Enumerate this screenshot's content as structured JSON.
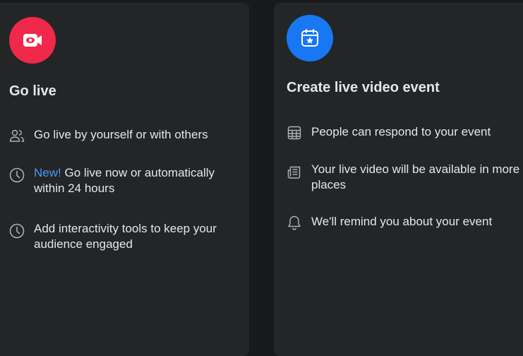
{
  "go_live": {
    "title": "Go live",
    "badge_color": "#f02849",
    "badge_icon": "video-camera-icon",
    "features": [
      {
        "icon": "people-icon",
        "text": "Go live by yourself or with others"
      },
      {
        "icon": "clock-icon",
        "tag": "New!",
        "text": "Go live now or automatically within 24 hours"
      },
      {
        "icon": "clock-icon",
        "text": "Add interactivity tools to keep your audience engaged"
      }
    ]
  },
  "live_event": {
    "title": "Create live video event",
    "badge_color": "#1877f2",
    "badge_icon": "calendar-star-icon",
    "features": [
      {
        "icon": "calendar-grid-icon",
        "text": "People can respond to your event"
      },
      {
        "icon": "news-feed-icon",
        "text": "Your live video will be available in more places"
      },
      {
        "icon": "bell-icon",
        "text": "We'll remind you about your event"
      }
    ]
  },
  "colors": {
    "background": "#18191a",
    "card": "#242526",
    "text": "#e4e6eb",
    "icon": "#b0b3b8",
    "new_tag": "#4599ff"
  }
}
